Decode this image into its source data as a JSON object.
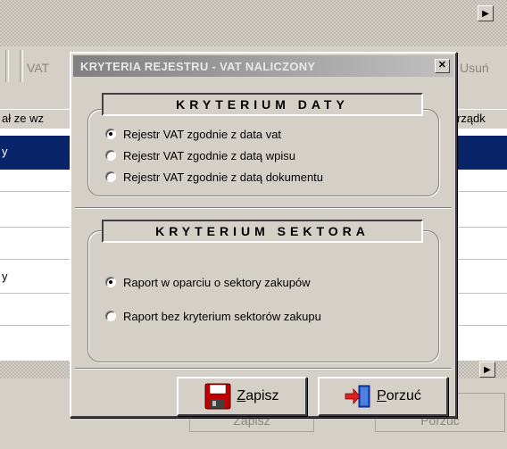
{
  "background_window": {
    "toolbar_vat": "VAT",
    "toolbar_usun": "Usuń",
    "col_left_header": "ał ze wz",
    "col_right_header": "rządk",
    "row_text_1": "y",
    "row_text_2": "y",
    "ghost_save": "Zapisz",
    "ghost_cancel": "Porzuć"
  },
  "dialog": {
    "title": "KRYTERIA REJESTRU - VAT NALICZONY",
    "close_glyph": "✕",
    "date_group": {
      "caption": "KRYTERIUM DATY",
      "options": [
        {
          "label": "Rejestr VAT zgodnie z data vat",
          "selected": true
        },
        {
          "label": "Rejestr VAT zgodnie z datą wpisu",
          "selected": false
        },
        {
          "label": "Rejestr VAT zgodnie z datą dokumentu",
          "selected": false
        }
      ]
    },
    "sector_group": {
      "caption": "KRYTERIUM SEKTORA",
      "options": [
        {
          "label": "Raport w oparciu o sektory zakupów",
          "selected": true
        },
        {
          "label": "Raport bez kryterium sektorów zakupu",
          "selected": false
        }
      ]
    },
    "buttons": {
      "save_hotkey": "Z",
      "save_rest": "apisz",
      "cancel_hotkey": "P",
      "cancel_rest": "orzuć"
    }
  },
  "icons": {
    "save": "floppy-disk-icon",
    "cancel": "exit-door-arrow-icon",
    "scroll_right": "arrow-right-icon"
  },
  "colors": {
    "face": "#d4d0c8",
    "selection": "#0a246a",
    "floppy": "#c00000"
  }
}
